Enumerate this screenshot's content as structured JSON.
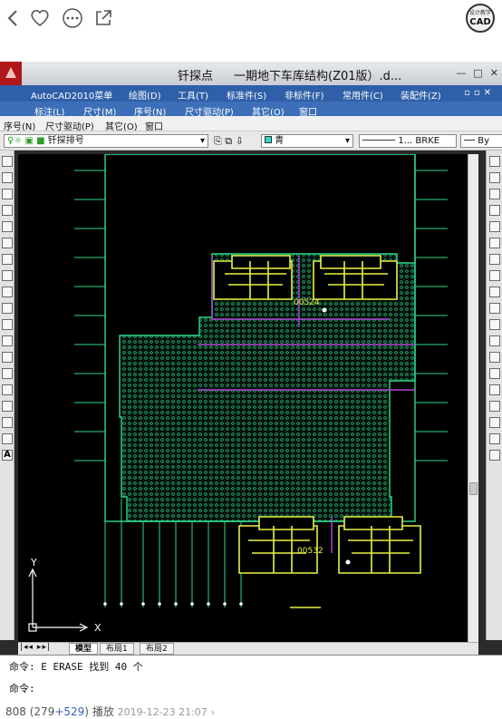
{
  "app": {
    "title_left": "钎探点",
    "title_right": "一期地下车库结构(Z01版）.d..."
  },
  "logo": {
    "line1": "设计教学",
    "line2": "CAD"
  },
  "menu1": [
    "AutoCAD2010菜单",
    "绘图(D)",
    "工具(T)",
    "标准件(S)",
    "非标件(F)",
    "常用件(C)",
    "装配件(Z)"
  ],
  "menu2": [
    "标注(L)",
    "尺寸(M)",
    "序号(N)",
    "尺寸驱动(P)",
    "其它(O)",
    "窗口"
  ],
  "menu3": [
    "序号(N)",
    "尺寸驱动(P)",
    "其它(O)",
    "窗口"
  ],
  "toolbar": {
    "layer": "钎探排号",
    "color": "青",
    "linetype": "1... BRKE",
    "lineweight": "By"
  },
  "drawing": {
    "label_a": "00524",
    "label_b": "00532",
    "axis_x": "X",
    "axis_y": "Y"
  },
  "tabs": [
    "模型",
    "布局1",
    "布局2"
  ],
  "command": {
    "line1": "命令: E ERASE 找到 40 个",
    "line2": "命令:"
  },
  "stats": {
    "views": "808",
    "open": "(",
    "likes": "279",
    "plus": "+529",
    "close": ")",
    "play": "播放",
    "date": "2019-12-23 21:07"
  },
  "colors": {
    "grid": "#2dd98a",
    "building": "#e7f244",
    "pipe": "#b14ad8"
  }
}
